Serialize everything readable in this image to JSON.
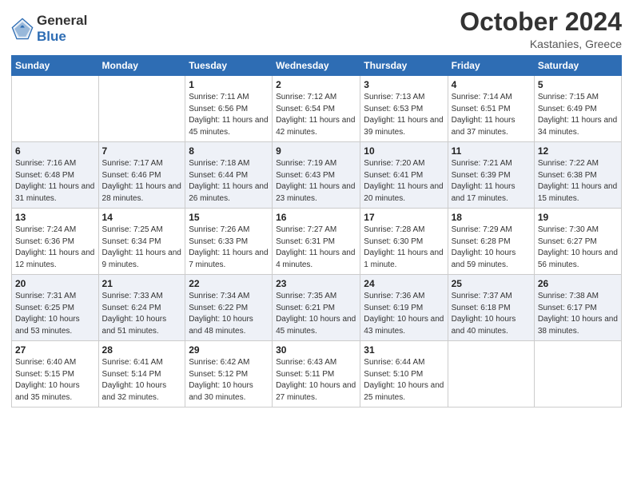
{
  "header": {
    "logo_general": "General",
    "logo_blue": "Blue",
    "month_title": "October 2024",
    "location": "Kastanies, Greece"
  },
  "days_of_week": [
    "Sunday",
    "Monday",
    "Tuesday",
    "Wednesday",
    "Thursday",
    "Friday",
    "Saturday"
  ],
  "weeks": [
    [
      {
        "day": "",
        "sunrise": "",
        "sunset": "",
        "daylight": ""
      },
      {
        "day": "",
        "sunrise": "",
        "sunset": "",
        "daylight": ""
      },
      {
        "day": "1",
        "sunrise": "Sunrise: 7:11 AM",
        "sunset": "Sunset: 6:56 PM",
        "daylight": "Daylight: 11 hours and 45 minutes."
      },
      {
        "day": "2",
        "sunrise": "Sunrise: 7:12 AM",
        "sunset": "Sunset: 6:54 PM",
        "daylight": "Daylight: 11 hours and 42 minutes."
      },
      {
        "day": "3",
        "sunrise": "Sunrise: 7:13 AM",
        "sunset": "Sunset: 6:53 PM",
        "daylight": "Daylight: 11 hours and 39 minutes."
      },
      {
        "day": "4",
        "sunrise": "Sunrise: 7:14 AM",
        "sunset": "Sunset: 6:51 PM",
        "daylight": "Daylight: 11 hours and 37 minutes."
      },
      {
        "day": "5",
        "sunrise": "Sunrise: 7:15 AM",
        "sunset": "Sunset: 6:49 PM",
        "daylight": "Daylight: 11 hours and 34 minutes."
      }
    ],
    [
      {
        "day": "6",
        "sunrise": "Sunrise: 7:16 AM",
        "sunset": "Sunset: 6:48 PM",
        "daylight": "Daylight: 11 hours and 31 minutes."
      },
      {
        "day": "7",
        "sunrise": "Sunrise: 7:17 AM",
        "sunset": "Sunset: 6:46 PM",
        "daylight": "Daylight: 11 hours and 28 minutes."
      },
      {
        "day": "8",
        "sunrise": "Sunrise: 7:18 AM",
        "sunset": "Sunset: 6:44 PM",
        "daylight": "Daylight: 11 hours and 26 minutes."
      },
      {
        "day": "9",
        "sunrise": "Sunrise: 7:19 AM",
        "sunset": "Sunset: 6:43 PM",
        "daylight": "Daylight: 11 hours and 23 minutes."
      },
      {
        "day": "10",
        "sunrise": "Sunrise: 7:20 AM",
        "sunset": "Sunset: 6:41 PM",
        "daylight": "Daylight: 11 hours and 20 minutes."
      },
      {
        "day": "11",
        "sunrise": "Sunrise: 7:21 AM",
        "sunset": "Sunset: 6:39 PM",
        "daylight": "Daylight: 11 hours and 17 minutes."
      },
      {
        "day": "12",
        "sunrise": "Sunrise: 7:22 AM",
        "sunset": "Sunset: 6:38 PM",
        "daylight": "Daylight: 11 hours and 15 minutes."
      }
    ],
    [
      {
        "day": "13",
        "sunrise": "Sunrise: 7:24 AM",
        "sunset": "Sunset: 6:36 PM",
        "daylight": "Daylight: 11 hours and 12 minutes."
      },
      {
        "day": "14",
        "sunrise": "Sunrise: 7:25 AM",
        "sunset": "Sunset: 6:34 PM",
        "daylight": "Daylight: 11 hours and 9 minutes."
      },
      {
        "day": "15",
        "sunrise": "Sunrise: 7:26 AM",
        "sunset": "Sunset: 6:33 PM",
        "daylight": "Daylight: 11 hours and 7 minutes."
      },
      {
        "day": "16",
        "sunrise": "Sunrise: 7:27 AM",
        "sunset": "Sunset: 6:31 PM",
        "daylight": "Daylight: 11 hours and 4 minutes."
      },
      {
        "day": "17",
        "sunrise": "Sunrise: 7:28 AM",
        "sunset": "Sunset: 6:30 PM",
        "daylight": "Daylight: 11 hours and 1 minute."
      },
      {
        "day": "18",
        "sunrise": "Sunrise: 7:29 AM",
        "sunset": "Sunset: 6:28 PM",
        "daylight": "Daylight: 10 hours and 59 minutes."
      },
      {
        "day": "19",
        "sunrise": "Sunrise: 7:30 AM",
        "sunset": "Sunset: 6:27 PM",
        "daylight": "Daylight: 10 hours and 56 minutes."
      }
    ],
    [
      {
        "day": "20",
        "sunrise": "Sunrise: 7:31 AM",
        "sunset": "Sunset: 6:25 PM",
        "daylight": "Daylight: 10 hours and 53 minutes."
      },
      {
        "day": "21",
        "sunrise": "Sunrise: 7:33 AM",
        "sunset": "Sunset: 6:24 PM",
        "daylight": "Daylight: 10 hours and 51 minutes."
      },
      {
        "day": "22",
        "sunrise": "Sunrise: 7:34 AM",
        "sunset": "Sunset: 6:22 PM",
        "daylight": "Daylight: 10 hours and 48 minutes."
      },
      {
        "day": "23",
        "sunrise": "Sunrise: 7:35 AM",
        "sunset": "Sunset: 6:21 PM",
        "daylight": "Daylight: 10 hours and 45 minutes."
      },
      {
        "day": "24",
        "sunrise": "Sunrise: 7:36 AM",
        "sunset": "Sunset: 6:19 PM",
        "daylight": "Daylight: 10 hours and 43 minutes."
      },
      {
        "day": "25",
        "sunrise": "Sunrise: 7:37 AM",
        "sunset": "Sunset: 6:18 PM",
        "daylight": "Daylight: 10 hours and 40 minutes."
      },
      {
        "day": "26",
        "sunrise": "Sunrise: 7:38 AM",
        "sunset": "Sunset: 6:17 PM",
        "daylight": "Daylight: 10 hours and 38 minutes."
      }
    ],
    [
      {
        "day": "27",
        "sunrise": "Sunrise: 6:40 AM",
        "sunset": "Sunset: 5:15 PM",
        "daylight": "Daylight: 10 hours and 35 minutes."
      },
      {
        "day": "28",
        "sunrise": "Sunrise: 6:41 AM",
        "sunset": "Sunset: 5:14 PM",
        "daylight": "Daylight: 10 hours and 32 minutes."
      },
      {
        "day": "29",
        "sunrise": "Sunrise: 6:42 AM",
        "sunset": "Sunset: 5:12 PM",
        "daylight": "Daylight: 10 hours and 30 minutes."
      },
      {
        "day": "30",
        "sunrise": "Sunrise: 6:43 AM",
        "sunset": "Sunset: 5:11 PM",
        "daylight": "Daylight: 10 hours and 27 minutes."
      },
      {
        "day": "31",
        "sunrise": "Sunrise: 6:44 AM",
        "sunset": "Sunset: 5:10 PM",
        "daylight": "Daylight: 10 hours and 25 minutes."
      },
      {
        "day": "",
        "sunrise": "",
        "sunset": "",
        "daylight": ""
      },
      {
        "day": "",
        "sunrise": "",
        "sunset": "",
        "daylight": ""
      }
    ]
  ]
}
